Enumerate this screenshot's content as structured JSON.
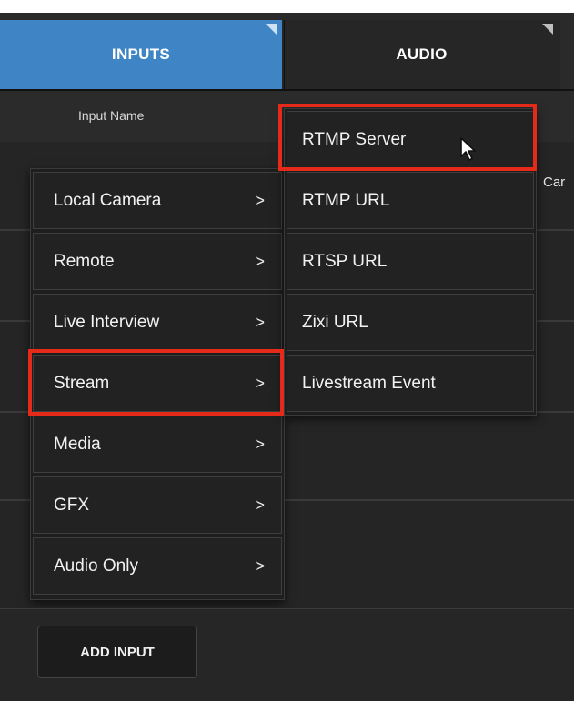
{
  "tabs": [
    {
      "label": "INPUTS",
      "active": true
    },
    {
      "label": "AUDIO",
      "active": false
    }
  ],
  "list_header": {
    "input_name": "Input Name",
    "partial_column": "Car"
  },
  "left_menu": {
    "items": [
      {
        "label": "Local Camera",
        "chevron": ">"
      },
      {
        "label": "Remote",
        "chevron": ">"
      },
      {
        "label": "Live Interview",
        "chevron": ">"
      },
      {
        "label": "Stream",
        "chevron": ">",
        "highlighted": true
      },
      {
        "label": "Media",
        "chevron": ">"
      },
      {
        "label": "GFX",
        "chevron": ">"
      },
      {
        "label": "Audio Only",
        "chevron": ">"
      }
    ]
  },
  "right_menu": {
    "items": [
      {
        "label": "RTMP Server",
        "highlighted": true
      },
      {
        "label": "RTMP URL"
      },
      {
        "label": "RTSP URL"
      },
      {
        "label": "Zixi URL"
      },
      {
        "label": "Livestream Event"
      }
    ]
  },
  "add_input": {
    "label": "ADD INPUT"
  },
  "colors": {
    "active_tab": "#3f85c5",
    "highlight": "#e62a1a",
    "background": "#252525"
  },
  "icons": {
    "cursor": "mouse-pointer-icon",
    "tab_corner": "tab-corner-icon"
  }
}
